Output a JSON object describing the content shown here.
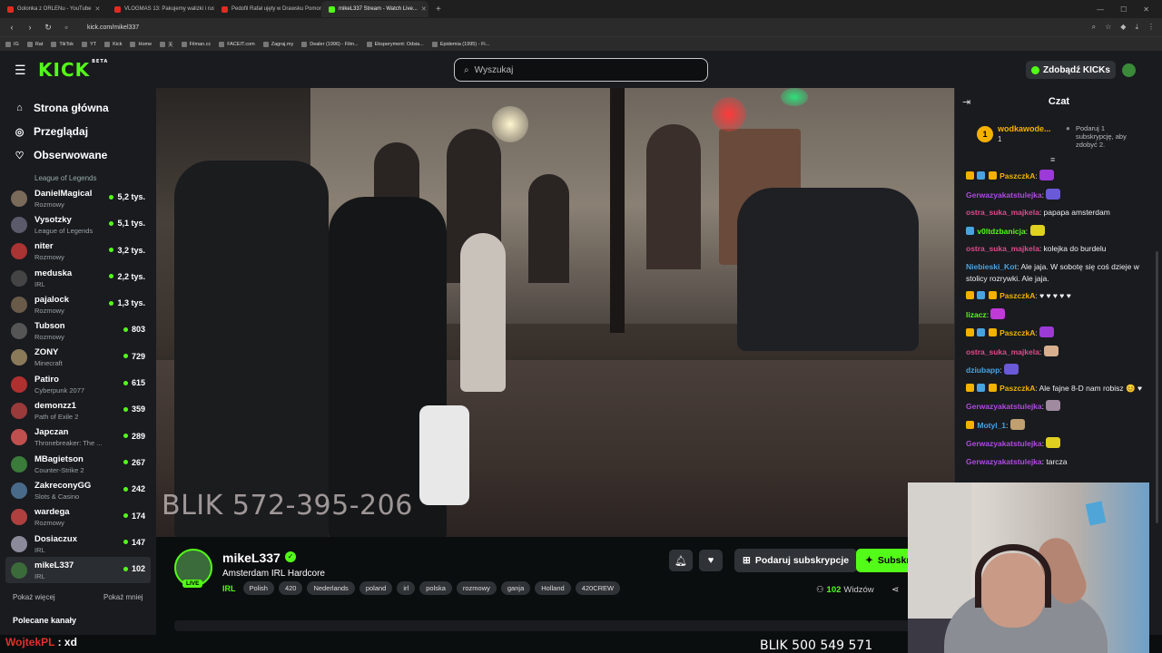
{
  "browser": {
    "tabs": [
      {
        "title": "Golonka z ORLENu - YouTube",
        "color": "#e02b20"
      },
      {
        "title": "VLOGMAS 13: Pakujemy walizki i ruszamy...",
        "color": "#e02b20"
      },
      {
        "title": "Pedofil Rafał ujęty w Drawsku Pomor...",
        "color": "#e02b20"
      },
      {
        "title": "mikeL337 Stream - Watch Live...",
        "color": "#53fc18"
      }
    ],
    "url": "kick.com/mikel337",
    "bookmarks": [
      "IG",
      "Rat",
      "TikTok",
      "YT",
      "Kick",
      "Home",
      "天",
      "Filman.cc",
      "FACEIT.com",
      "Zagraj.my",
      "Dealer (1996) - Film...",
      "Eksperyment: Odsia...",
      "Epidemia (1995) - Fi..."
    ]
  },
  "header": {
    "logo": "KICK",
    "logo_sup": "BETA",
    "search_placeholder": "Wyszukaj",
    "get_kicks": "Zdobądź KICKs"
  },
  "sidebar": {
    "nav": [
      {
        "label": "Strona główna",
        "icon": "home-icon"
      },
      {
        "label": "Przeglądaj",
        "icon": "compass-icon"
      },
      {
        "label": "Obserwowane",
        "icon": "heart-icon"
      }
    ],
    "top_partial_category": "League of Legends",
    "channels": [
      {
        "name": "DanielMagical",
        "category": "Rozmowy",
        "viewers": "5,2 tys.",
        "color": "#7a6a5a"
      },
      {
        "name": "Vysotzky",
        "category": "League of Legends",
        "viewers": "5,1 tys.",
        "color": "#5a5a6a"
      },
      {
        "name": "niter",
        "category": "Rozmowy",
        "viewers": "3,2 tys.",
        "color": "#a33"
      },
      {
        "name": "meduska",
        "category": "IRL",
        "viewers": "2,2 tys.",
        "color": "#444"
      },
      {
        "name": "pajalock",
        "category": "Rozmowy",
        "viewers": "1,3 tys.",
        "color": "#6a5a4a"
      },
      {
        "name": "Tubson",
        "category": "Rozmowy",
        "viewers": "803",
        "color": "#555"
      },
      {
        "name": "ZONY",
        "category": "Minecraft",
        "viewers": "729",
        "color": "#8a7a5a"
      },
      {
        "name": "Patiro",
        "category": "Cyberpunk 2077",
        "viewers": "615",
        "color": "#b03030"
      },
      {
        "name": "demonzz1",
        "category": "Path of Exile 2",
        "viewers": "359",
        "color": "#9a3a3a"
      },
      {
        "name": "Japczan",
        "category": "Thronebreaker: The ...",
        "viewers": "289",
        "color": "#c05050"
      },
      {
        "name": "MBagietson",
        "category": "Counter-Strike 2",
        "viewers": "267",
        "color": "#3a7a3a"
      },
      {
        "name": "ZakreconyGG",
        "category": "Slots & Casino",
        "viewers": "242",
        "color": "#4a6a8a"
      },
      {
        "name": "wardega",
        "category": "Rozmowy",
        "viewers": "174",
        "color": "#b04040"
      },
      {
        "name": "Dosiaczux",
        "category": "IRL",
        "viewers": "147",
        "color": "#8a8a9a"
      },
      {
        "name": "mikeL337",
        "category": "IRL",
        "viewers": "102",
        "color": "#3b6a3b"
      }
    ],
    "show_more": "Pokaż więcej",
    "show_less": "Pokaż mniej",
    "recommended": "Polecane kanały"
  },
  "video": {
    "overlay_text": "BLIK 572-395-206"
  },
  "stream": {
    "name": "mikeL337",
    "live": "LIVE",
    "title": "Amsterdam IRL Hardcore",
    "category": "IRL",
    "tags": [
      "Polish",
      "420",
      "Nederlands",
      "poland",
      "irl",
      "polska",
      "rozmowy",
      "ganja",
      "Holland",
      "420CREW"
    ],
    "gift_button": "Podaruj subskrypcje",
    "subscribe_button": "Subskr",
    "viewers_count": "102",
    "viewers_label": "Widzów"
  },
  "chat": {
    "title": "Czat",
    "pinned": {
      "rank": "1",
      "user": "wodkawode...",
      "count": "1",
      "note": "Podaruj 1 subskrypcję, aby zdobyć 2."
    },
    "divider": "≡",
    "messages": [
      {
        "user": "PaszczkA",
        "color": "#f5b000",
        "badges": [
          "#f5b000",
          "#4aa3df",
          "#f5b000"
        ],
        "text": ":",
        "emote": "#9c3ad8"
      },
      {
        "user": "Gerwazyakatstulejka",
        "color": "#b04ae0",
        "badges": [],
        "text": ":",
        "emote": "#6a5ad8"
      },
      {
        "user": "ostra_suka_majkela",
        "color": "#e0488a",
        "badges": [],
        "text": ": papapa amsterdam",
        "emote": ""
      },
      {
        "user": "v0ltdzbanicja",
        "color": "#53fc18",
        "badges": [
          "#4aa3df"
        ],
        "text": ":",
        "emote": "#e0d020"
      },
      {
        "user": "ostra_suka_majkela",
        "color": "#e0488a",
        "badges": [],
        "text": ": kolejka do burdelu",
        "emote": ""
      },
      {
        "user": "Niebieski_Kot",
        "color": "#4aa3df",
        "badges": [],
        "text": ": Ale jaja. W sobotę się coś dzieje w stolicy rozrywki. Ale jaja.",
        "emote": ""
      },
      {
        "user": "PaszczkA",
        "color": "#f5b000",
        "badges": [
          "#f5b000",
          "#4aa3df",
          "#f5b000"
        ],
        "text": ": ♥ ♥ ♥ ♥ ♥",
        "emote": ""
      },
      {
        "user": "lizacz",
        "color": "#53fc18",
        "badges": [],
        "text": ":",
        "emote": "#c03ad8"
      },
      {
        "user": "PaszczkA",
        "color": "#f5b000",
        "badges": [
          "#f5b000",
          "#4aa3df",
          "#f5b000"
        ],
        "text": ":",
        "emote": "#9c3ad8"
      },
      {
        "user": "ostra_suka_majkela",
        "color": "#e0488a",
        "badges": [],
        "text": ":",
        "emote": "#d8b090"
      },
      {
        "user": "dziubapp",
        "color": "#4aa3df",
        "badges": [],
        "text": ":",
        "emote": "#6a5ad8"
      },
      {
        "user": "PaszczkA",
        "color": "#f5b000",
        "badges": [
          "#f5b000",
          "#4aa3df",
          "#f5b000"
        ],
        "text": ": Ale fajne 8-D nam robisz 😊 ♥",
        "emote": ""
      },
      {
        "user": "Gerwazyakatstulejka",
        "color": "#b04ae0",
        "badges": [],
        "text": ":",
        "emote": "#a08aa0"
      },
      {
        "user": "Motyl_1",
        "color": "#4aa3df",
        "badges": [
          "#f5b000"
        ],
        "text": ":",
        "emote": "#c0a070"
      },
      {
        "user": "Gerwazyakatstulejka",
        "color": "#b04ae0",
        "badges": [],
        "text": ":",
        "emote": "#e0d020"
      },
      {
        "user": "Gerwazyakatstulejka",
        "color": "#b04ae0",
        "badges": [],
        "text": ": tarcza",
        "emote": ""
      }
    ]
  },
  "overlay": {
    "chat_user": "WojtekPL",
    "chat_text": " : xd",
    "blik_bottom": "BLIK 500 549 571"
  },
  "colors": {
    "brand": "#53fc18",
    "background": "#0b0e0f",
    "panel": "#191b1f"
  }
}
